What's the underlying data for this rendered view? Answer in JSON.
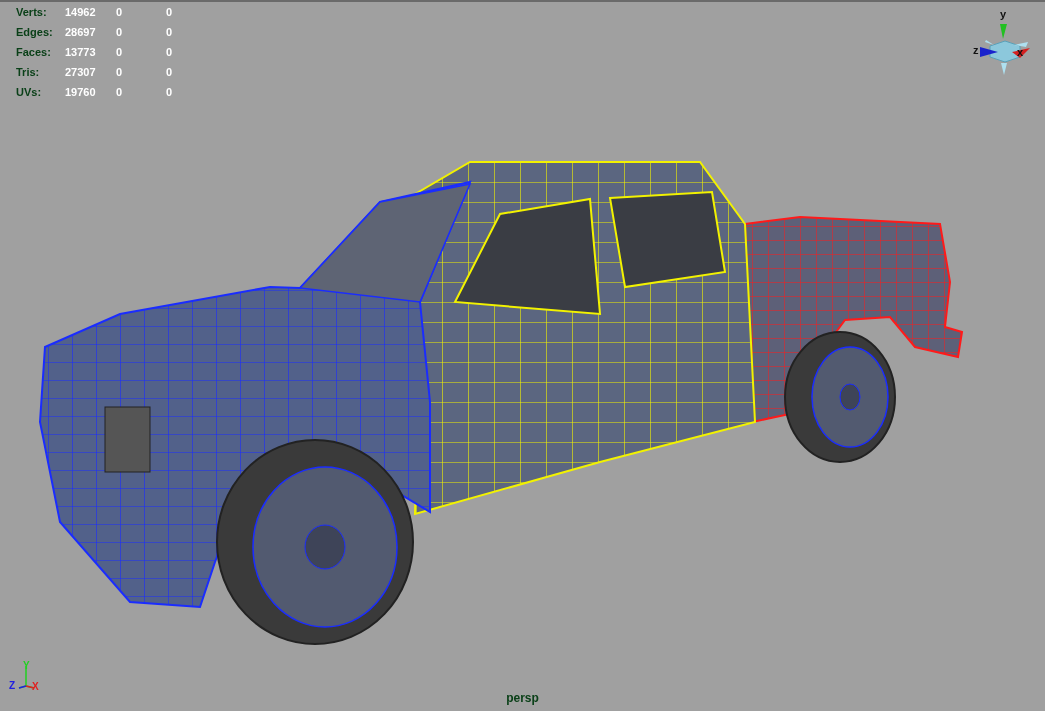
{
  "viewport": {
    "camera": "persp",
    "stats": [
      {
        "label": "Verts:",
        "values": [
          "14962",
          "0",
          "0"
        ]
      },
      {
        "label": "Edges:",
        "values": [
          "28697",
          "0",
          "0"
        ]
      },
      {
        "label": "Faces:",
        "values": [
          "13773",
          "0",
          "0"
        ]
      },
      {
        "label": "Tris:",
        "values": [
          "27307",
          "0",
          "0"
        ]
      },
      {
        "label": "UVs:",
        "values": [
          "19760",
          "0",
          "0"
        ]
      }
    ],
    "view_cube": {
      "y": "y",
      "z": "z",
      "x": "x"
    },
    "axis_triad": {
      "y": "Y",
      "z": "Z",
      "x": "X"
    }
  }
}
